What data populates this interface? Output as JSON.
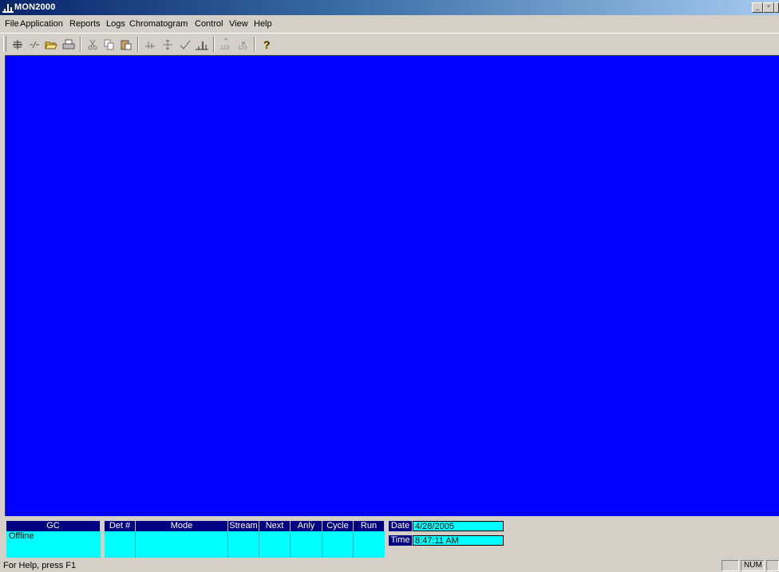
{
  "window": {
    "title": "MON2000"
  },
  "menu": [
    "File",
    "Application",
    "Reports",
    "Logs",
    "Chromatogram",
    "Control",
    "View",
    "Help"
  ],
  "toolbar_icons": [
    "connect-icon",
    "disconnect-icon",
    "open-folder-icon",
    "print-icon",
    "cut-icon",
    "copy-icon",
    "paste-icon",
    "peak-icon",
    "crosshair-icon",
    "check-icon",
    "chromatogram-icon",
    "increase-123-icon",
    "decrease-123-icon",
    "help-icon"
  ],
  "gc_panel": {
    "gc_header": "GC",
    "gc_status": "Offline",
    "columns": [
      "Det #",
      "Mode",
      "Stream",
      "Next",
      "Anly",
      "Cycle",
      "Run"
    ],
    "date_label": "Date",
    "date_value": "4/28/2005",
    "time_label": "Time",
    "time_value": "8:47:11 AM"
  },
  "statusbar": {
    "help_text": "For Help, press F1",
    "num_indicator": "NUM"
  },
  "colors": {
    "client_bg": "#0000ff",
    "panel_cell": "#00ffff",
    "header_bg": "#000080"
  }
}
